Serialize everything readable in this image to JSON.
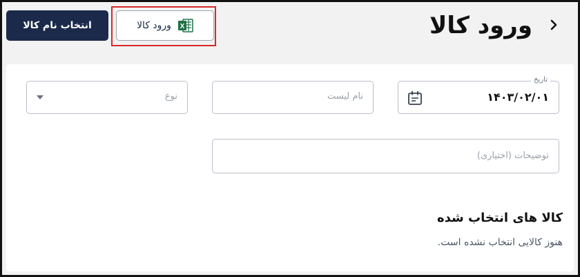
{
  "header": {
    "title": "ورود کالا",
    "back_icon": "chevron-right-icon",
    "select_product_label": "انتخاب نام کالا",
    "import_label": "ورود کالا",
    "import_icon": "excel-icon"
  },
  "form": {
    "date": {
      "label": "تاریخ",
      "value": "۱۴۰۳/۰۲/۰۱",
      "icon": "calendar-icon"
    },
    "list_name": {
      "placeholder": "نام لیست",
      "value": ""
    },
    "type": {
      "placeholder": "نوع",
      "icon": "dropdown-arrow-icon"
    },
    "description": {
      "placeholder": "توضیحات (اختیاری)",
      "value": ""
    }
  },
  "selected": {
    "title": "کالا های انتخاب شده",
    "empty_text": "هنوز کالایی انتخاب نشده است."
  },
  "colors": {
    "primary": "#1b2a4a",
    "highlight": "#d62828",
    "excel_green": "#1e7145"
  }
}
